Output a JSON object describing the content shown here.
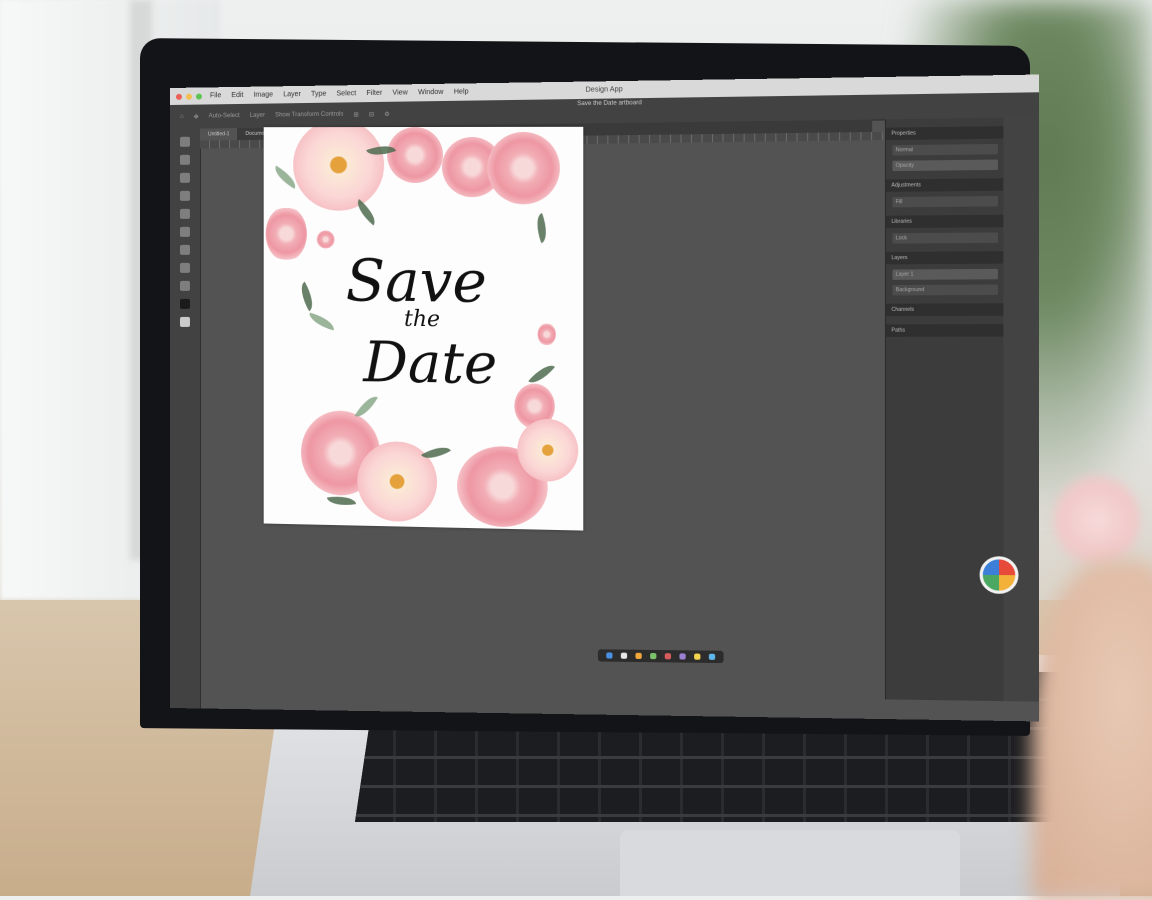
{
  "app": {
    "title": "Design App",
    "document_title": "Save the Date artboard"
  },
  "menu": {
    "items": [
      "File",
      "Edit",
      "Image",
      "Layer",
      "Type",
      "Select",
      "Filter",
      "View",
      "Window",
      "Help"
    ]
  },
  "options_bar": {
    "labels": [
      "Auto-Select",
      "Layer",
      "Show Transform Controls"
    ]
  },
  "tabs": [
    {
      "label": "Untitled-1"
    },
    {
      "label": "Document"
    }
  ],
  "panel": {
    "sections": [
      "Properties",
      "Adjustments",
      "Libraries",
      "Layers",
      "Channels",
      "Paths"
    ],
    "rows": [
      "Normal",
      "Opacity",
      "Fill",
      "Lock",
      "Layer 1",
      "Background"
    ]
  },
  "invitation": {
    "line1": "Save",
    "line2": "the",
    "line3": "Date"
  },
  "colors": {
    "canvas": "#535353",
    "panel": "#3c3c3c",
    "menubar": "#d9d9d9",
    "accent_pink": "#ee97a3"
  },
  "icons": [
    "move-icon",
    "marquee-icon",
    "lasso-icon",
    "crop-icon",
    "brush-icon",
    "eraser-icon",
    "text-icon",
    "hand-icon",
    "zoom-icon",
    "creative-cloud-icon"
  ]
}
